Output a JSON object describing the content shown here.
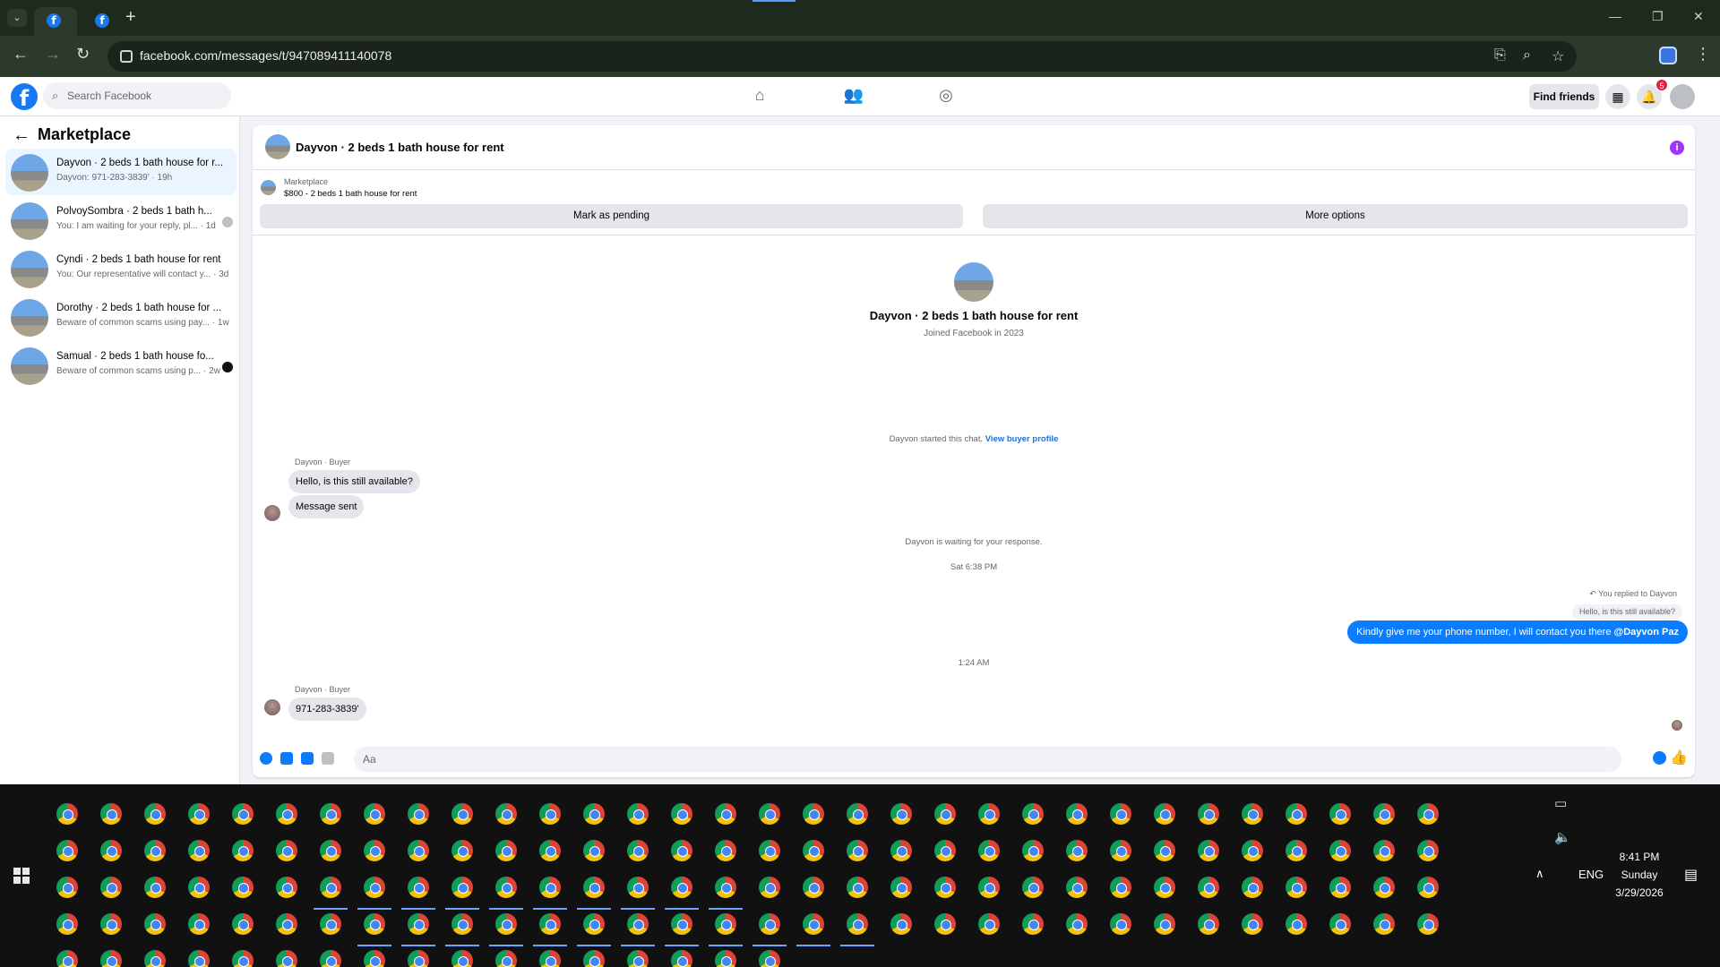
{
  "browser": {
    "url": "facebook.com/messages/t/947089411140078",
    "new_tab_glyph": "+",
    "minimize_glyph": "—",
    "restore_glyph": "❐",
    "close_glyph": "✕"
  },
  "fb_header": {
    "search_placeholder": "Search Facebook",
    "find_friends": "Find friends",
    "notification_count": "5"
  },
  "sidebar": {
    "title": "Marketplace",
    "conversations": [
      {
        "name": "Dayvon · 2 beds 1 bath house for r...",
        "preview": "Dayvon: 971-283-3839' · 19h"
      },
      {
        "name": "PolvoySombra · 2 beds 1 bath h...",
        "preview": "You: I am waiting for your reply, pl... · 1d"
      },
      {
        "name": "Cyndi · 2 beds 1 bath house for rent",
        "preview": "You: Our representative will contact y... · 3d"
      },
      {
        "name": "Dorothy · 2 beds 1 bath house for ...",
        "preview": "Beware of common scams using pay... · 1w"
      },
      {
        "name": "Samual · 2 beds 1 bath house fo...",
        "preview": "Beware of common scams using p... · 2w"
      }
    ]
  },
  "chat": {
    "title": "Dayvon · 2 beds 1 bath house for rent",
    "listing_source": "Marketplace",
    "listing_detail": "$800 - 2 beds 1 bath house for rent",
    "mark_pending": "Mark as pending",
    "more_options": "More options",
    "profile_name": "Dayvon · 2 beds 1 bath house for rent",
    "profile_sub": "Joined Facebook in 2023",
    "started_text": "Dayvon started this chat.",
    "view_buyer": "View buyer profile",
    "sender_label": "Dayvon · Buyer",
    "msg1": "Hello, is this still available?",
    "msg2": "Message sent",
    "waiting": "Dayvon is waiting for your response.",
    "time1": "Sat 6:38 PM",
    "replied_label": "You replied to Dayvon",
    "quoted": "Hello, is this still available?",
    "outgoing_text": "Kindly give me your phone number, I will contact you there ",
    "outgoing_mention": "@Dayvon Paz",
    "time2": "1:24 AM",
    "msg3": "971-283-3839'",
    "composer_placeholder": "Aa"
  },
  "taskbar": {
    "language": "ENG",
    "time": "8:41 PM",
    "day": "Sunday",
    "date": "3/29/2026"
  }
}
